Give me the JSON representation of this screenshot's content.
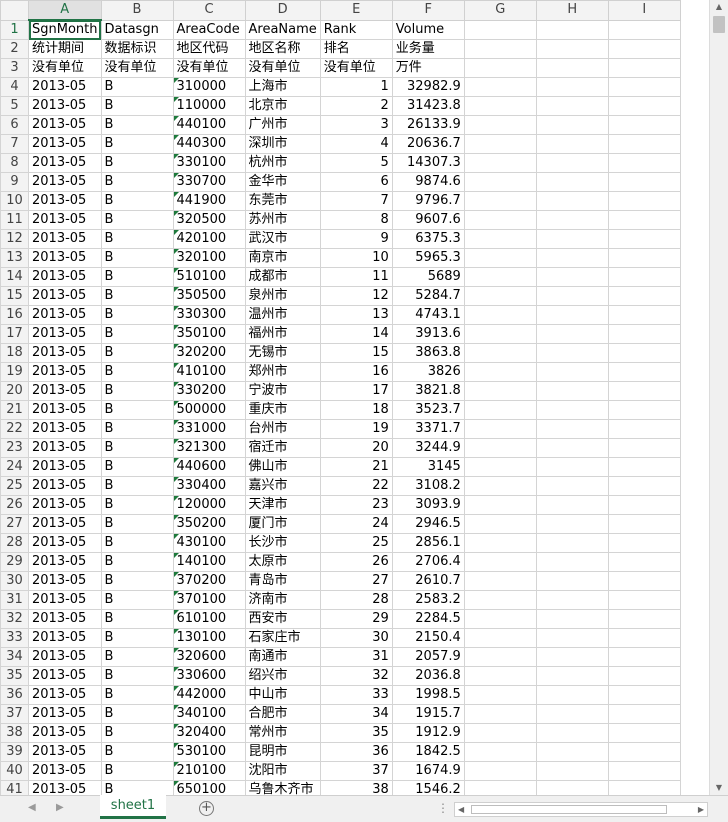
{
  "columns": [
    "A",
    "B",
    "C",
    "D",
    "E",
    "F",
    "G",
    "H",
    "I"
  ],
  "rows": [
    [
      "SgnMonth",
      "Datasgn",
      "AreaCode",
      "AreaName",
      "Rank",
      "Volume"
    ],
    [
      "统计期间",
      "数据标识",
      "地区代码",
      "地区名称",
      "排名",
      "业务量"
    ],
    [
      "没有单位",
      "没有单位",
      "没有单位",
      "没有单位",
      "没有单位",
      "万件"
    ],
    [
      "2013-05",
      "B",
      "310000",
      "上海市",
      "1",
      "32982.9"
    ],
    [
      "2013-05",
      "B",
      "110000",
      "北京市",
      "2",
      "31423.8"
    ],
    [
      "2013-05",
      "B",
      "440100",
      "广州市",
      "3",
      "26133.9"
    ],
    [
      "2013-05",
      "B",
      "440300",
      "深圳市",
      "4",
      "20636.7"
    ],
    [
      "2013-05",
      "B",
      "330100",
      "杭州市",
      "5",
      "14307.3"
    ],
    [
      "2013-05",
      "B",
      "330700",
      "金华市",
      "6",
      "9874.6"
    ],
    [
      "2013-05",
      "B",
      "441900",
      "东莞市",
      "7",
      "9796.7"
    ],
    [
      "2013-05",
      "B",
      "320500",
      "苏州市",
      "8",
      "9607.6"
    ],
    [
      "2013-05",
      "B",
      "420100",
      "武汉市",
      "9",
      "6375.3"
    ],
    [
      "2013-05",
      "B",
      "320100",
      "南京市",
      "10",
      "5965.3"
    ],
    [
      "2013-05",
      "B",
      "510100",
      "成都市",
      "11",
      "5689"
    ],
    [
      "2013-05",
      "B",
      "350500",
      "泉州市",
      "12",
      "5284.7"
    ],
    [
      "2013-05",
      "B",
      "330300",
      "温州市",
      "13",
      "4743.1"
    ],
    [
      "2013-05",
      "B",
      "350100",
      "福州市",
      "14",
      "3913.6"
    ],
    [
      "2013-05",
      "B",
      "320200",
      "无锡市",
      "15",
      "3863.8"
    ],
    [
      "2013-05",
      "B",
      "410100",
      "郑州市",
      "16",
      "3826"
    ],
    [
      "2013-05",
      "B",
      "330200",
      "宁波市",
      "17",
      "3821.8"
    ],
    [
      "2013-05",
      "B",
      "500000",
      "重庆市",
      "18",
      "3523.7"
    ],
    [
      "2013-05",
      "B",
      "331000",
      "台州市",
      "19",
      "3371.7"
    ],
    [
      "2013-05",
      "B",
      "321300",
      "宿迁市",
      "20",
      "3244.9"
    ],
    [
      "2013-05",
      "B",
      "440600",
      "佛山市",
      "21",
      "3145"
    ],
    [
      "2013-05",
      "B",
      "330400",
      "嘉兴市",
      "22",
      "3108.2"
    ],
    [
      "2013-05",
      "B",
      "120000",
      "天津市",
      "23",
      "3093.9"
    ],
    [
      "2013-05",
      "B",
      "350200",
      "厦门市",
      "24",
      "2946.5"
    ],
    [
      "2013-05",
      "B",
      "430100",
      "长沙市",
      "25",
      "2856.1"
    ],
    [
      "2013-05",
      "B",
      "140100",
      "太原市",
      "26",
      "2706.4"
    ],
    [
      "2013-05",
      "B",
      "370200",
      "青岛市",
      "27",
      "2610.7"
    ],
    [
      "2013-05",
      "B",
      "370100",
      "济南市",
      "28",
      "2583.2"
    ],
    [
      "2013-05",
      "B",
      "610100",
      "西安市",
      "29",
      "2284.5"
    ],
    [
      "2013-05",
      "B",
      "130100",
      "石家庄市",
      "30",
      "2150.4"
    ],
    [
      "2013-05",
      "B",
      "320600",
      "南通市",
      "31",
      "2057.9"
    ],
    [
      "2013-05",
      "B",
      "330600",
      "绍兴市",
      "32",
      "2036.8"
    ],
    [
      "2013-05",
      "B",
      "442000",
      "中山市",
      "33",
      "1998.5"
    ],
    [
      "2013-05",
      "B",
      "340100",
      "合肥市",
      "34",
      "1915.7"
    ],
    [
      "2013-05",
      "B",
      "320400",
      "常州市",
      "35",
      "1912.9"
    ],
    [
      "2013-05",
      "B",
      "530100",
      "昆明市",
      "36",
      "1842.5"
    ],
    [
      "2013-05",
      "B",
      "210100",
      "沈阳市",
      "37",
      "1674.9"
    ],
    [
      "2013-05",
      "B",
      "650100",
      "乌鲁木齐市",
      "38",
      "1546.2"
    ]
  ],
  "sheet_tab": "sheet1",
  "add_sheet_symbol": "+",
  "active_cell": "A1",
  "colors": {
    "accent": "#217346",
    "header_bg": "#f3f3f3",
    "grid_line": "#d4d4d4"
  }
}
